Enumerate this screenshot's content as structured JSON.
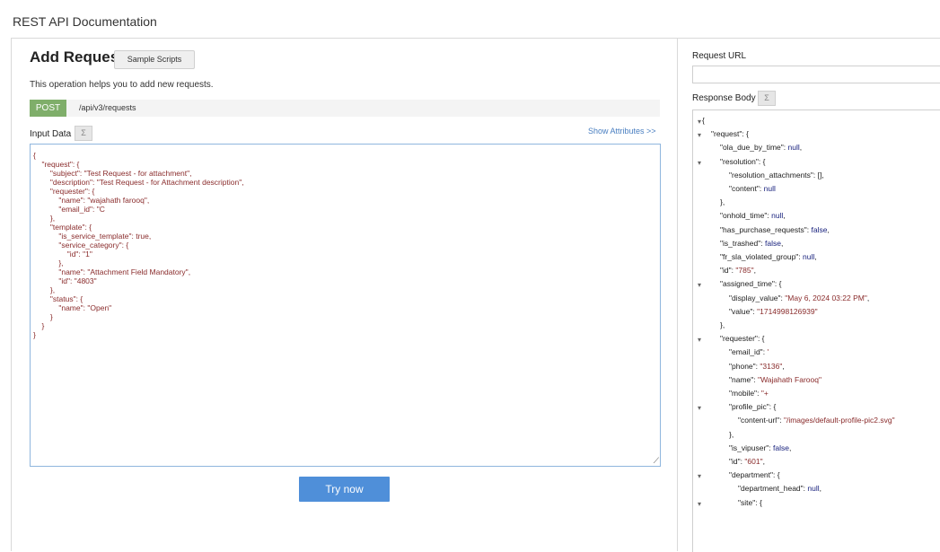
{
  "header": {
    "title": "REST API Documentation"
  },
  "left": {
    "heading": "Add Request",
    "sample_scripts": "Sample Scripts",
    "description": "This operation helps you to add new requests.",
    "method": "POST",
    "endpoint": "/api/v3/requests",
    "input_label": "Input Data",
    "sort_icon": "Σ",
    "show_attributes": "Show Attributes >>",
    "input_json": "{\n    \"request\": {\n        \"subject\": \"Test Request - for attachment\",\n        \"description\": \"Test Request - for Attachment description\",\n        \"requester\": {\n            \"name\": \"wajahath farooq\",\n            \"email_id\": \"C\n        },\n        \"template\": {\n            \"is_service_template\": true,\n            \"service_category\": {\n                \"id\": \"1\"\n            },\n            \"name\": \"Attachment Field Mandatory\",\n            \"id\": \"4803\"\n        },\n        \"status\": {\n            \"name\": \"Open\"\n        }\n    }\n}",
    "try_now": "Try now"
  },
  "right": {
    "request_url_label": "Request URL",
    "response_body_label": "Response Body",
    "sort_icon": "Σ",
    "response_lines": [
      {
        "indent": 0,
        "toggle": true,
        "parts": [
          [
            "b",
            "{"
          ]
        ]
      },
      {
        "indent": 1,
        "toggle": true,
        "parts": [
          [
            "k",
            "\"request\""
          ],
          [
            "b",
            ": {"
          ]
        ]
      },
      {
        "indent": 2,
        "toggle": false,
        "parts": [
          [
            "k",
            "\"ola_due_by_time\""
          ],
          [
            "b",
            ": "
          ],
          [
            "n",
            "null"
          ],
          [
            "b",
            ","
          ]
        ]
      },
      {
        "indent": 2,
        "toggle": true,
        "parts": [
          [
            "k",
            "\"resolution\""
          ],
          [
            "b",
            ": {"
          ]
        ]
      },
      {
        "indent": 3,
        "toggle": false,
        "parts": [
          [
            "k",
            "\"resolution_attachments\""
          ],
          [
            "b",
            ": [],"
          ]
        ]
      },
      {
        "indent": 3,
        "toggle": false,
        "parts": [
          [
            "k",
            "\"content\""
          ],
          [
            "b",
            ": "
          ],
          [
            "n",
            "null"
          ]
        ]
      },
      {
        "indent": 2,
        "toggle": false,
        "parts": [
          [
            "b",
            "},"
          ]
        ]
      },
      {
        "indent": 2,
        "toggle": false,
        "parts": [
          [
            "k",
            "\"onhold_time\""
          ],
          [
            "b",
            ": "
          ],
          [
            "n",
            "null"
          ],
          [
            "b",
            ","
          ]
        ]
      },
      {
        "indent": 2,
        "toggle": false,
        "parts": [
          [
            "k",
            "\"has_purchase_requests\""
          ],
          [
            "b",
            ": "
          ],
          [
            "n",
            "false"
          ],
          [
            "b",
            ","
          ]
        ]
      },
      {
        "indent": 2,
        "toggle": false,
        "parts": [
          [
            "k",
            "\"is_trashed\""
          ],
          [
            "b",
            ": "
          ],
          [
            "n",
            "false"
          ],
          [
            "b",
            ","
          ]
        ]
      },
      {
        "indent": 2,
        "toggle": false,
        "parts": [
          [
            "k",
            "\"fr_sla_violated_group\""
          ],
          [
            "b",
            ": "
          ],
          [
            "n",
            "null"
          ],
          [
            "b",
            ","
          ]
        ]
      },
      {
        "indent": 2,
        "toggle": false,
        "parts": [
          [
            "k",
            "\"id\""
          ],
          [
            "b",
            ": "
          ],
          [
            "s",
            "\"785\""
          ],
          [
            "b",
            ","
          ]
        ]
      },
      {
        "indent": 2,
        "toggle": true,
        "parts": [
          [
            "k",
            "\"assigned_time\""
          ],
          [
            "b",
            ": {"
          ]
        ]
      },
      {
        "indent": 3,
        "toggle": false,
        "parts": [
          [
            "k",
            "\"display_value\""
          ],
          [
            "b",
            ": "
          ],
          [
            "s",
            "\"May 6, 2024 03:22 PM\""
          ],
          [
            "b",
            ","
          ]
        ]
      },
      {
        "indent": 3,
        "toggle": false,
        "parts": [
          [
            "k",
            "\"value\""
          ],
          [
            "b",
            ": "
          ],
          [
            "s",
            "\"1714998126939\""
          ]
        ]
      },
      {
        "indent": 2,
        "toggle": false,
        "parts": [
          [
            "b",
            "},"
          ]
        ]
      },
      {
        "indent": 2,
        "toggle": true,
        "parts": [
          [
            "k",
            "\"requester\""
          ],
          [
            "b",
            ": {"
          ]
        ]
      },
      {
        "indent": 3,
        "toggle": false,
        "parts": [
          [
            "k",
            "\"email_id\""
          ],
          [
            "b",
            ": "
          ],
          [
            "s",
            "'"
          ]
        ]
      },
      {
        "indent": 3,
        "toggle": false,
        "parts": [
          [
            "k",
            "\"phone\""
          ],
          [
            "b",
            ": "
          ],
          [
            "s",
            "\"3136\""
          ],
          [
            "b",
            ","
          ]
        ]
      },
      {
        "indent": 3,
        "toggle": false,
        "parts": [
          [
            "k",
            "\"name\""
          ],
          [
            "b",
            ": "
          ],
          [
            "s",
            "\"Wajahath Farooq\""
          ]
        ]
      },
      {
        "indent": 3,
        "toggle": false,
        "parts": [
          [
            "k",
            "\"mobile\""
          ],
          [
            "b",
            ": "
          ],
          [
            "s",
            "\"+"
          ]
        ]
      },
      {
        "indent": 3,
        "toggle": true,
        "parts": [
          [
            "k",
            "\"profile_pic\""
          ],
          [
            "b",
            ": {"
          ]
        ]
      },
      {
        "indent": 4,
        "toggle": false,
        "parts": [
          [
            "k",
            "\"content-url\""
          ],
          [
            "b",
            ": "
          ],
          [
            "s",
            "\"/images/default-profile-pic2.svg\""
          ]
        ]
      },
      {
        "indent": 3,
        "toggle": false,
        "parts": [
          [
            "b",
            "},"
          ]
        ]
      },
      {
        "indent": 3,
        "toggle": false,
        "parts": [
          [
            "k",
            "\"is_vipuser\""
          ],
          [
            "b",
            ": "
          ],
          [
            "n",
            "false"
          ],
          [
            "b",
            ","
          ]
        ]
      },
      {
        "indent": 3,
        "toggle": false,
        "parts": [
          [
            "k",
            "\"id\""
          ],
          [
            "b",
            ": "
          ],
          [
            "s",
            "\"601\""
          ],
          [
            "b",
            ","
          ]
        ]
      },
      {
        "indent": 3,
        "toggle": true,
        "parts": [
          [
            "k",
            "\"department\""
          ],
          [
            "b",
            ": {"
          ]
        ]
      },
      {
        "indent": 4,
        "toggle": false,
        "parts": [
          [
            "k",
            "\"department_head\""
          ],
          [
            "b",
            ": "
          ],
          [
            "n",
            "null"
          ],
          [
            "b",
            ","
          ]
        ]
      },
      {
        "indent": 4,
        "toggle": true,
        "parts": [
          [
            "k",
            "\"site\""
          ],
          [
            "b",
            ": {"
          ]
        ]
      }
    ]
  }
}
